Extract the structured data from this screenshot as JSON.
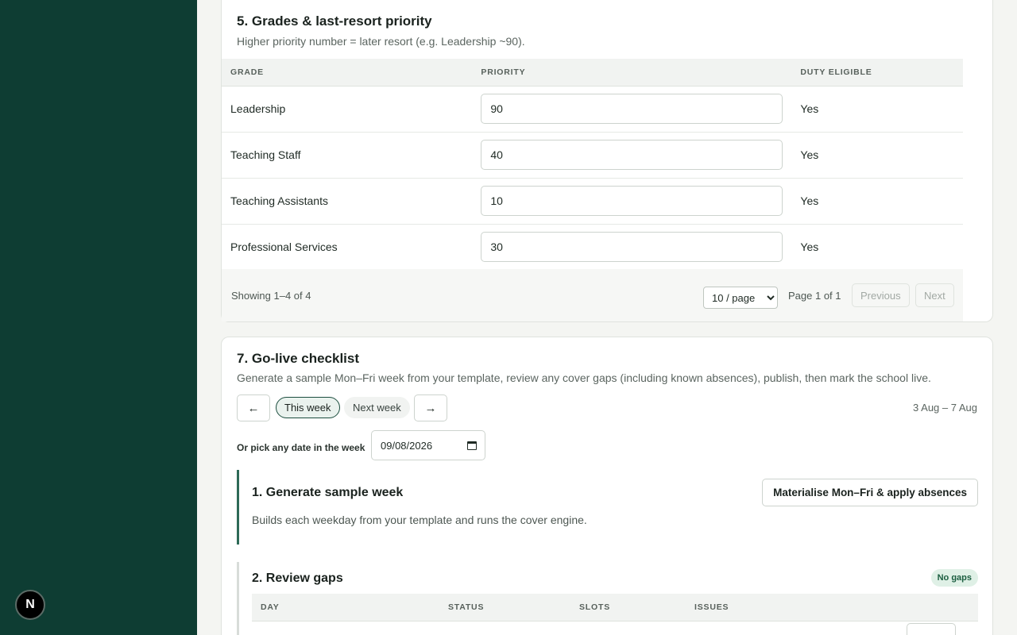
{
  "sidebar": {
    "badge_letter": "N"
  },
  "grades_section": {
    "title": "5. Grades & last-resort priority",
    "subtitle": "Higher priority number = later resort (e.g. Leadership ~90).",
    "columns": [
      "GRADE",
      "PRIORITY",
      "DUTY ELIGIBLE"
    ],
    "rows": [
      {
        "grade": "Leadership",
        "priority": "90",
        "duty_eligible": "Yes"
      },
      {
        "grade": "Teaching Staff",
        "priority": "40",
        "duty_eligible": "Yes"
      },
      {
        "grade": "Teaching Assistants",
        "priority": "10",
        "duty_eligible": "Yes"
      },
      {
        "grade": "Professional Services",
        "priority": "30",
        "duty_eligible": "Yes"
      }
    ],
    "pagination": {
      "showing": "Showing 1–4 of 4",
      "per_page": "10 / page",
      "page_of": "Page 1 of 1",
      "previous": "Previous",
      "next": "Next"
    }
  },
  "golive_section": {
    "title": "7. Go-live checklist",
    "subtitle": "Generate a sample Mon–Fri week from your template, review any cover gaps (including known absences), publish, then mark the school live.",
    "prev_arrow": "←",
    "next_arrow": "→",
    "this_week": "This week",
    "next_week": "Next week",
    "date_range": "3 Aug – 7 Aug",
    "pick_label": "Or pick any date in the week",
    "date_value": "09/08/2026",
    "step1": {
      "title": "1. Generate sample week",
      "desc": "Builds each weekday from your template and runs the cover engine.",
      "button": "Materialise Mon–Fri & apply absences"
    },
    "step2": {
      "title": "2. Review gaps",
      "badge": "No gaps",
      "columns": [
        "DAY",
        "STATUS",
        "SLOTS",
        "ISSUES"
      ]
    }
  }
}
